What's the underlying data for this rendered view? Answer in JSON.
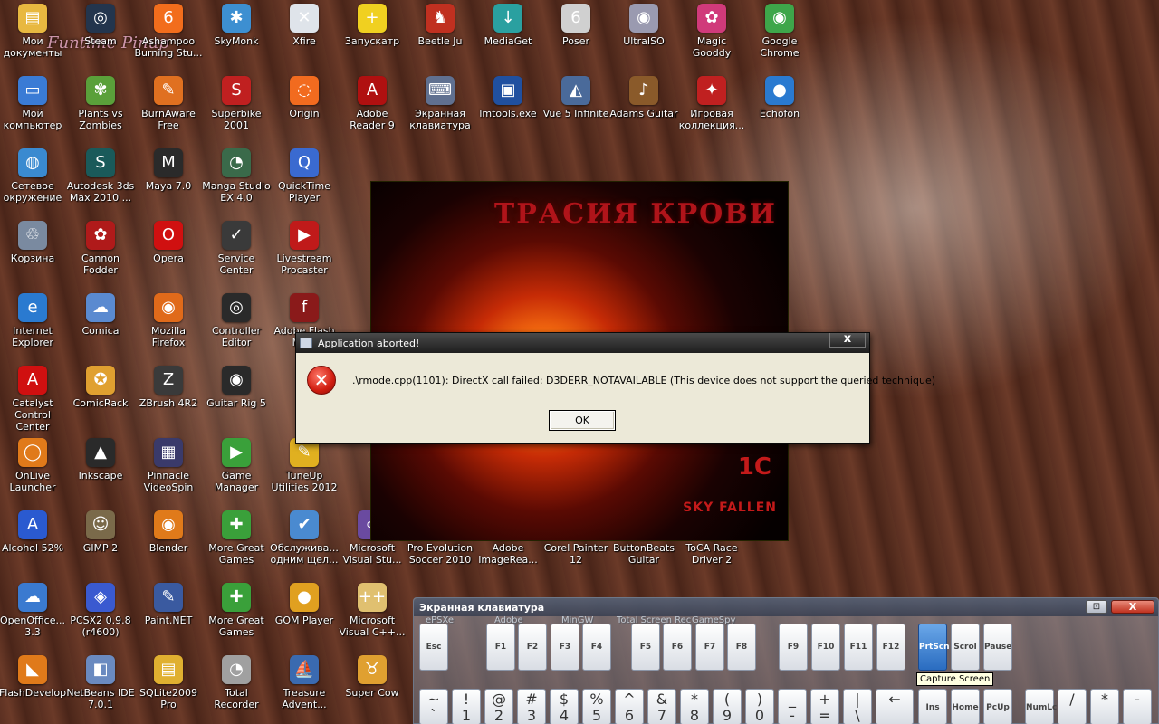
{
  "desktop": {
    "icons": [
      {
        "label": "Мои документы",
        "icon": "folder-icon",
        "color": "#e8b840",
        "glyph": "▤"
      },
      {
        "label": "Steam",
        "icon": "steam-icon",
        "color": "#23354d",
        "glyph": "◎"
      },
      {
        "label": "Ashampoo Burning Stu...",
        "icon": "ashampoo-icon",
        "color": "#f26d1c",
        "glyph": "6"
      },
      {
        "label": "SkyMonk",
        "icon": "skymonk-icon",
        "color": "#3d8fd1",
        "glyph": "✱"
      },
      {
        "label": "Xfire",
        "icon": "xfire-icon",
        "color": "#dfe4ea",
        "glyph": "✕"
      },
      {
        "label": "Запускатр",
        "icon": "launcher-icon",
        "color": "#f0d020",
        "glyph": "+"
      },
      {
        "label": "Beetle Ju",
        "icon": "beetle-icon",
        "color": "#c03020",
        "glyph": "♞"
      },
      {
        "label": "MediaGet",
        "icon": "mediaget-icon",
        "color": "#2aa0a0",
        "glyph": "↓"
      },
      {
        "label": "Poser",
        "icon": "poser-icon",
        "color": "#d0d0d0",
        "glyph": "6"
      },
      {
        "label": "UltraISO",
        "icon": "ultraiso-icon",
        "color": "#9a9ab0",
        "glyph": "◉"
      },
      {
        "label": "Magic Gooddy",
        "icon": "magic-gooddy-icon",
        "color": "#d03a7a",
        "glyph": "✿"
      },
      {
        "label": "Google Chrome",
        "icon": "chrome-icon",
        "color": "#3ea64a",
        "glyph": "◉"
      },
      {
        "label": "Мой компьютер",
        "icon": "computer-icon",
        "color": "#3a7bd5",
        "glyph": "▭"
      },
      {
        "label": "Plants vs Zombies",
        "icon": "pvz-icon",
        "color": "#5aa03a",
        "glyph": "✾"
      },
      {
        "label": "BurnAware Free",
        "icon": "burnaware-icon",
        "color": "#e07020",
        "glyph": "✎"
      },
      {
        "label": "Superbike 2001",
        "icon": "superbike-icon",
        "color": "#c02020",
        "glyph": "S"
      },
      {
        "label": "Origin",
        "icon": "origin-icon",
        "color": "#f26b1f",
        "glyph": "◌"
      },
      {
        "label": "Adobe Reader 9",
        "icon": "adobe-reader-icon",
        "color": "#b01010",
        "glyph": "A"
      },
      {
        "label": "Экранная клавиатура",
        "icon": "keyboard-icon",
        "color": "#607090",
        "glyph": "⌨"
      },
      {
        "label": "lmtools.exe",
        "icon": "lmtools-icon",
        "color": "#2050a0",
        "glyph": "▣"
      },
      {
        "label": "Vue 5 Infinite",
        "icon": "vue-icon",
        "color": "#4a6a9a",
        "glyph": "◭"
      },
      {
        "label": "Adams Guitar",
        "icon": "guitar-icon",
        "color": "#8a5a2a",
        "glyph": "♪"
      },
      {
        "label": "Игровая коллекция...",
        "icon": "game-collection-icon",
        "color": "#c02020",
        "glyph": "✦"
      },
      {
        "label": "Echofon",
        "icon": "echofon-icon",
        "color": "#2a7ad0",
        "glyph": "●"
      },
      {
        "label": "Сетевое окружение",
        "icon": "network-icon",
        "color": "#3a8ad0",
        "glyph": "◍"
      },
      {
        "label": "Autodesk 3ds Max 2010 ...",
        "icon": "3dsmax-icon",
        "color": "#1a5a5a",
        "glyph": "S"
      },
      {
        "label": "Maya 7.0",
        "icon": "maya-icon",
        "color": "#2a2a2a",
        "glyph": "M"
      },
      {
        "label": "Manga Studio EX 4.0",
        "icon": "manga-studio-icon",
        "color": "#3a6a4a",
        "glyph": "◔"
      },
      {
        "label": "QuickTime Player",
        "icon": "quicktime-icon",
        "color": "#3a6ad0",
        "glyph": "Q"
      },
      {
        "label": "Корзина",
        "icon": "recycle-bin-icon",
        "color": "#7a8aa0",
        "glyph": "♲"
      },
      {
        "label": "Cannon Fodder",
        "icon": "cannon-fodder-icon",
        "color": "#b01a1a",
        "glyph": "✿"
      },
      {
        "label": "Opera",
        "icon": "opera-icon",
        "color": "#d01010",
        "glyph": "O"
      },
      {
        "label": "Service Center",
        "icon": "service-center-icon",
        "color": "#3a3a3a",
        "glyph": "✓"
      },
      {
        "label": "Livestream Procaster",
        "icon": "livestream-icon",
        "color": "#c01a1a",
        "glyph": "▶"
      },
      {
        "label": "Internet Explorer",
        "icon": "ie-icon",
        "color": "#2a7ad0",
        "glyph": "e"
      },
      {
        "label": "Comica",
        "icon": "comica-icon",
        "color": "#5a8ad0",
        "glyph": "☁"
      },
      {
        "label": "Mozilla Firefox",
        "icon": "firefox-icon",
        "color": "#e06a1a",
        "glyph": "◉"
      },
      {
        "label": "Controller Editor",
        "icon": "controller-editor-icon",
        "color": "#2a2a2a",
        "glyph": "◎"
      },
      {
        "label": "Adobe Flash Me...",
        "icon": "flash-icon",
        "color": "#8a1a1a",
        "glyph": "f"
      },
      {
        "label": "Catalyst Control Center",
        "icon": "catalyst-icon",
        "color": "#d01010",
        "glyph": "A"
      },
      {
        "label": "ComicRack",
        "icon": "comicrack-icon",
        "color": "#e0a030",
        "glyph": "✪"
      },
      {
        "label": "ZBrush 4R2",
        "icon": "zbrush-icon",
        "color": "#3a3a3a",
        "glyph": "Z"
      },
      {
        "label": "Guitar Rig 5",
        "icon": "guitar-rig-icon",
        "color": "#2a2a2a",
        "glyph": "◉"
      },
      {
        "label": "OnLive Launcher",
        "icon": "onlive-icon",
        "color": "#e07a1a",
        "glyph": "◯"
      },
      {
        "label": "Inkscape",
        "icon": "inkscape-icon",
        "color": "#2a2a2a",
        "glyph": "▲"
      },
      {
        "label": "Pinnacle VideoSpin",
        "icon": "pinnacle-icon",
        "color": "#3a3a6a",
        "glyph": "▦"
      },
      {
        "label": "Game Manager",
        "icon": "game-manager-icon",
        "color": "#3aa03a",
        "glyph": "▶"
      },
      {
        "label": "TuneUp Utilities 2012",
        "icon": "tuneup-icon",
        "color": "#e0b020",
        "glyph": "✎"
      },
      {
        "label": "Alcohol 52%",
        "icon": "alcohol-icon",
        "color": "#2a5ad0",
        "glyph": "A"
      },
      {
        "label": "GIMP 2",
        "icon": "gimp-icon",
        "color": "#7a6a4a",
        "glyph": "☺"
      },
      {
        "label": "Blender",
        "icon": "blender-icon",
        "color": "#e07a1a",
        "glyph": "◉"
      },
      {
        "label": "More Great Games",
        "icon": "more-games-icon",
        "color": "#3aa03a",
        "glyph": "✚"
      },
      {
        "label": "Обслужива... одним щел...",
        "icon": "maintenance-icon",
        "color": "#4a8ad0",
        "glyph": "✔"
      },
      {
        "label": "Microsoft Visual Stu...",
        "icon": "visual-studio-icon",
        "color": "#6a4aa0",
        "glyph": "∞"
      },
      {
        "label": "Pro Evolution Soccer 2010",
        "icon": "pes-icon",
        "color": "#2a2a6a",
        "glyph": "⚽"
      },
      {
        "label": "Adobe ImageRea...",
        "icon": "imageready-icon",
        "color": "#3a5a9a",
        "glyph": "Ir"
      },
      {
        "label": "Corel Painter 12",
        "icon": "corel-painter-icon",
        "color": "#7a3a1a",
        "glyph": "✐"
      },
      {
        "label": "ButtonBeats Guitar",
        "icon": "buttonbeats-icon",
        "color": "#6a4a2a",
        "glyph": "♫"
      },
      {
        "label": "ToCA Race Driver 2",
        "icon": "toca-icon",
        "color": "#3a3a3a",
        "glyph": "◈"
      },
      {
        "label": "OpenOffice... 3.3",
        "icon": "openoffice-icon",
        "color": "#3a7ad0",
        "glyph": "☁"
      },
      {
        "label": "PCSX2 0.9.8 (r4600)",
        "icon": "pcsx2-icon",
        "color": "#3a5ad0",
        "glyph": "◈"
      },
      {
        "label": "Paint.NET",
        "icon": "paintnet-icon",
        "color": "#3a5aa0",
        "glyph": "✎"
      },
      {
        "label": "More Great Games",
        "icon": "more-games-2-icon",
        "color": "#3aa03a",
        "glyph": "✚"
      },
      {
        "label": "GOM Player",
        "icon": "gom-player-icon",
        "color": "#e0a020",
        "glyph": "●"
      },
      {
        "label": "Microsoft Visual C++...",
        "icon": "visual-cpp-icon",
        "color": "#e0c070",
        "glyph": "++"
      },
      {
        "label": "FlashDevelop",
        "icon": "flashdevelop-icon",
        "color": "#e07a1a",
        "glyph": "◣"
      },
      {
        "label": "NetBeans IDE 7.0.1",
        "icon": "netbeans-icon",
        "color": "#6a8ac0",
        "glyph": "◧"
      },
      {
        "label": "SQLite2009 Pro",
        "icon": "sqlite-icon",
        "color": "#e0b030",
        "glyph": "▤"
      },
      {
        "label": "Total Recorder",
        "icon": "total-recorder-icon",
        "color": "#a0a0a0",
        "glyph": "◔"
      },
      {
        "label": "Treasure Advent...",
        "icon": "treasure-icon",
        "color": "#3a6ab0",
        "glyph": "⛵"
      },
      {
        "label": "Super Cow",
        "icon": "super-cow-icon",
        "color": "#e0a030",
        "glyph": "♉"
      }
    ],
    "behind_labels": [
      "ePSXe",
      "Adobe",
      "MinGW",
      "Total Screen Rec",
      "GameSpy"
    ],
    "watermark": "Funtime Pinup"
  },
  "game": {
    "title": "ТРАСИЯ КРОВИ",
    "publisher": "1C",
    "developer": "SKY FALLEN"
  },
  "dialog": {
    "title": "Application aborted!",
    "close_label": "x",
    "message": ".\\rmode.cpp(1101): DirectX call failed: D3DERR_NOTAVAILABLE (This device does not support the queried technique)",
    "ok_label": "OK"
  },
  "keyboard": {
    "title": "Экранная клавиатура",
    "close_label": "X",
    "tooltip": "Capture Screen",
    "fn_keys": [
      {
        "label": "Esc"
      },
      {
        "label": "F1"
      },
      {
        "label": "F2"
      },
      {
        "label": "F3"
      },
      {
        "label": "F4"
      },
      {
        "label": "F5"
      },
      {
        "label": "F6"
      },
      {
        "label": "F7"
      },
      {
        "label": "F8"
      },
      {
        "label": "F9"
      },
      {
        "label": "F10"
      },
      {
        "label": "F11"
      },
      {
        "label": "F12"
      },
      {
        "label": "PrtScn"
      },
      {
        "label": "Scrol"
      },
      {
        "label": "Pause"
      }
    ],
    "num_keys": [
      "~",
      "!",
      "@",
      "#",
      "$",
      "%",
      "^",
      "&",
      "*",
      "(",
      ")",
      "_",
      "+",
      "|",
      "←",
      "Ins",
      "Home",
      "PcUp",
      "NumLc",
      "/",
      "*",
      "-"
    ],
    "num_keys_bottom": [
      "`",
      "1",
      "2",
      "3",
      "4",
      "5",
      "6",
      "7",
      "8",
      "9",
      "0",
      "-",
      "=",
      "\\",
      "",
      "",
      "",
      "",
      "",
      "",
      "",
      ""
    ]
  }
}
